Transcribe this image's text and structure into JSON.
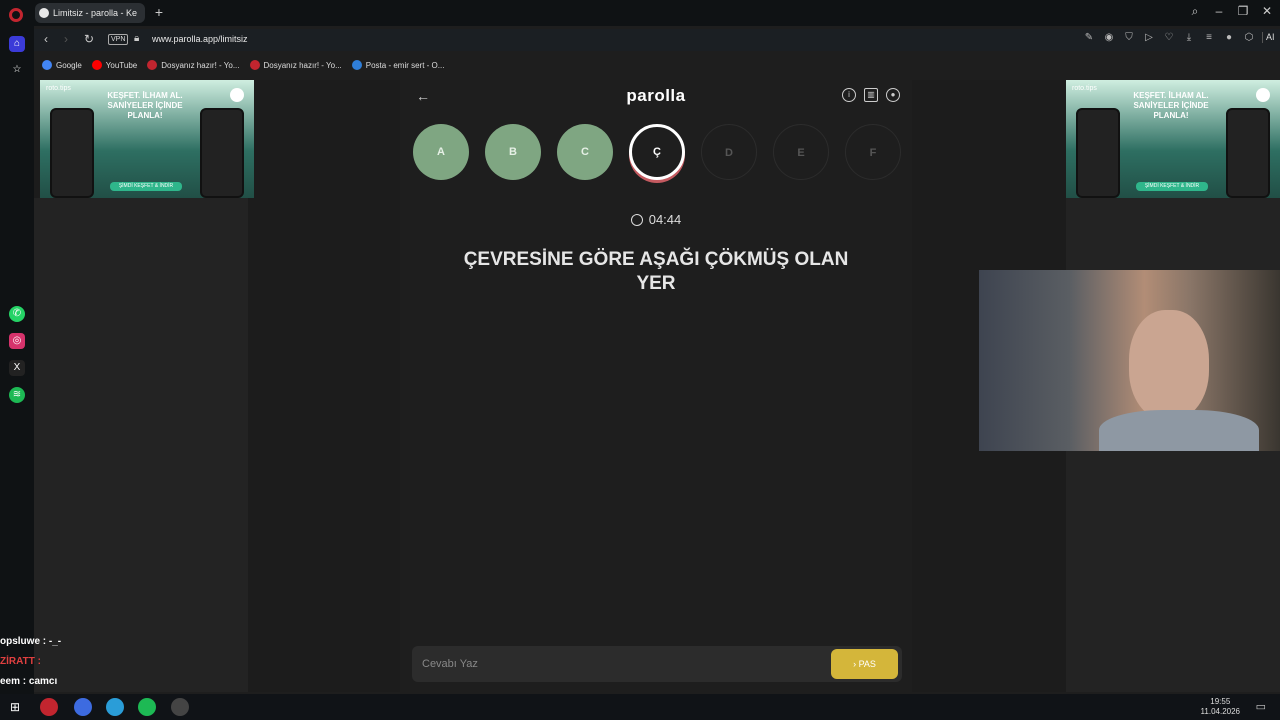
{
  "browser": {
    "tab_title": "Limitsiz - parolla - Ke",
    "url": "www.parolla.app/limitsiz",
    "vpn_label": "VPN",
    "ai_label": "AI"
  },
  "bookmarks": [
    {
      "label": "Google",
      "color": "#4285f4"
    },
    {
      "label": "YouTube",
      "color": "#ff0000"
    },
    {
      "label": "Dosyanız hazır! - Yo...",
      "color": "#c2252f"
    },
    {
      "label": "Dosyanız hazır! - Yo...",
      "color": "#c2252f"
    },
    {
      "label": "Posta - emir sert - O...",
      "color": "#2f7ed8"
    }
  ],
  "ad": {
    "brand": "roto.tips",
    "slogan": "KEŞFET. İLHAM AL. SANİYELER İÇİNDE PLANLA!",
    "cta": "ŞİMDİ KEŞFET & İNDİR"
  },
  "game": {
    "logo": "parolla",
    "letters": [
      {
        "char": "A",
        "state": "done"
      },
      {
        "char": "B",
        "state": "done"
      },
      {
        "char": "C",
        "state": "done"
      },
      {
        "char": "Ç",
        "state": "active"
      },
      {
        "char": "D",
        "state": "todo"
      },
      {
        "char": "E",
        "state": "todo"
      },
      {
        "char": "F",
        "state": "todo"
      }
    ],
    "timer": "04:44",
    "question": "ÇEVRESİNE GÖRE AŞAĞI ÇÖKMÜŞ OLAN YER",
    "answer_placeholder": "Cevabı Yaz",
    "pass_label": "PAS"
  },
  "chat": [
    "opsluwe : -_-",
    "ZİRATT :",
    "eem : camcı"
  ],
  "taskbar": {
    "time": "19:55",
    "date": "11.04.2026"
  },
  "colors": {
    "done_letter": "#7fa682",
    "pass_button": "#d4b63a",
    "active_ring": "#c45a60"
  }
}
